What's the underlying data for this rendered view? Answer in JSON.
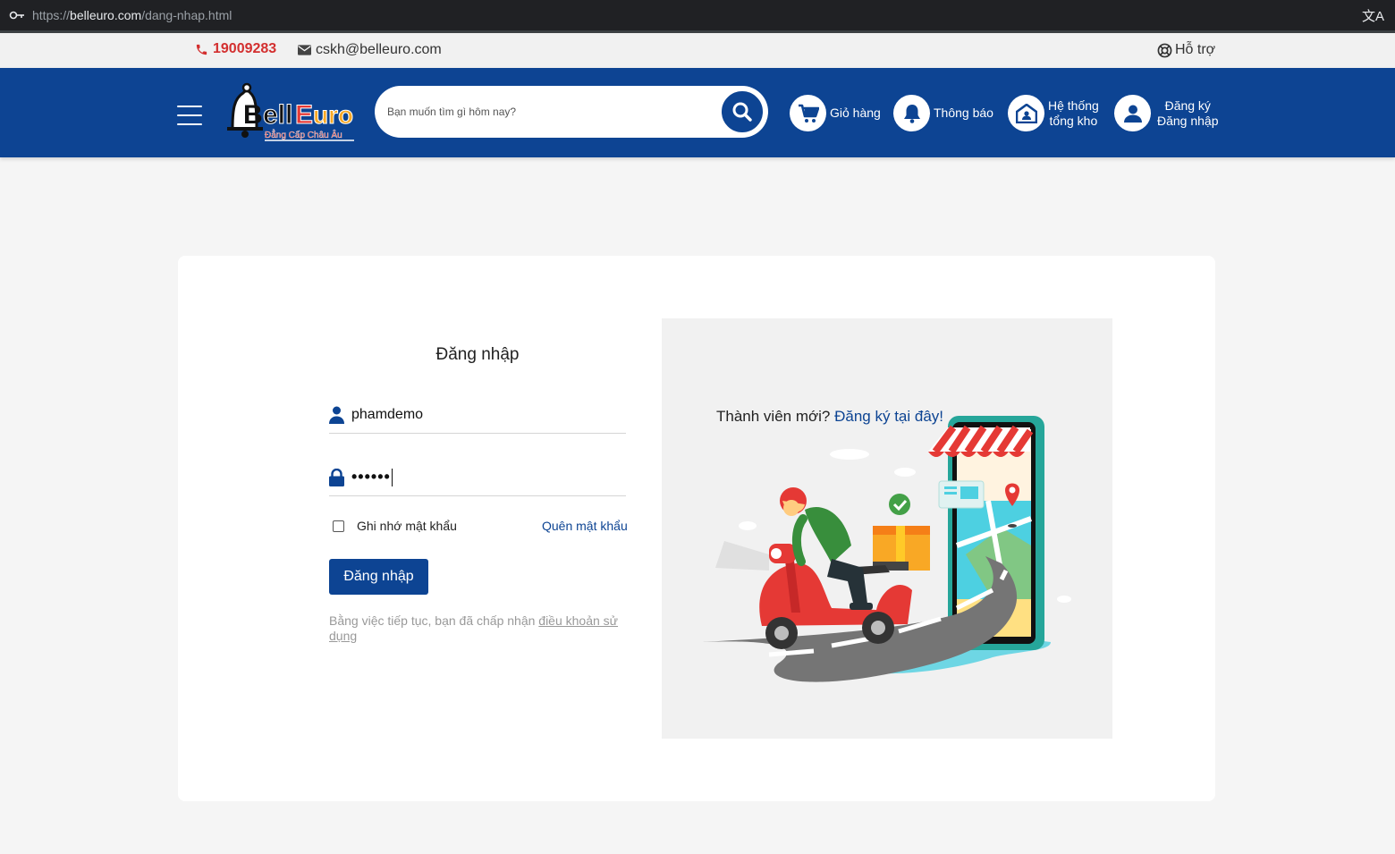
{
  "browser": {
    "url_prefix": "https://",
    "url_domain": "belleuro.com",
    "url_path": "/dang-nhap.html"
  },
  "topbar": {
    "phone": "19009283",
    "email": "cskh@belleuro.com",
    "support": "Hỗ trợ"
  },
  "header": {
    "logo_text_1": "Bell",
    "logo_text_2": "Euro",
    "logo_tagline": "Đẳng Cấp Châu Âu",
    "search_placeholder": "Bạn muốn tìm gì hôm nay?",
    "cart_label": "Giỏ hàng",
    "notify_label": "Thông báo",
    "warehouse_line1": "Hệ thống",
    "warehouse_line2": "tổng kho",
    "account_line1": "Đăng ký",
    "account_line2": "Đăng nhập"
  },
  "login": {
    "title": "Đăng nhập",
    "username_value": "phamdemo",
    "password_mask": "••••••",
    "remember_label": "Ghi nhớ mật khẩu",
    "forgot_label": "Quên mật khẩu",
    "submit_label": "Đăng nhập",
    "terms_prefix": "Bằng việc tiếp tục, bạn đã chấp nhận ",
    "terms_link": "điều khoản sử dụng"
  },
  "promo": {
    "new_member": "Thành viên mới? ",
    "register_link": "Đăng ký tại đây!"
  },
  "colors": {
    "brand_blue": "#0d4493",
    "phone_red": "#d32f2f",
    "background": "#f5f5f5"
  },
  "icons": [
    "key-icon",
    "translate-icon",
    "phone-icon",
    "mail-icon",
    "lifebuoy-icon",
    "hamburger-icon",
    "search-icon",
    "cart-icon",
    "bell-icon",
    "warehouse-icon",
    "user-icon",
    "lock-icon"
  ]
}
